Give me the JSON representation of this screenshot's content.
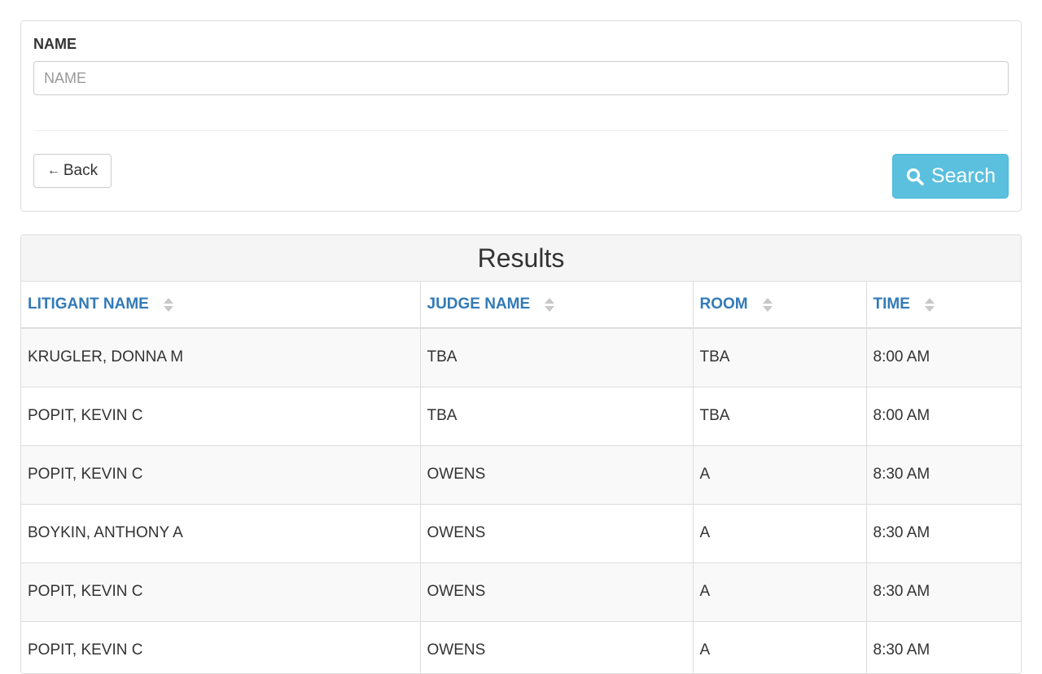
{
  "search_form": {
    "name_label": "NAME",
    "name_placeholder": "NAME",
    "name_value": "",
    "back_label": "Back",
    "back_arrow": "←",
    "search_label": "Search",
    "search_icon": "search-icon",
    "search_color": "#5bc0de"
  },
  "results": {
    "heading": "Results",
    "link_color": "#337ab7",
    "columns": [
      {
        "label": "LITIGANT NAME",
        "sort_icon": "sort-icon"
      },
      {
        "label": "JUDGE NAME",
        "sort_icon": "sort-icon"
      },
      {
        "label": "ROOM",
        "sort_icon": "sort-icon"
      },
      {
        "label": "TIME",
        "sort_icon": "sort-icon"
      }
    ],
    "rows": [
      {
        "litigant": "KRUGLER, DONNA M",
        "judge": "TBA",
        "room": "TBA",
        "time": "8:00 AM"
      },
      {
        "litigant": "POPIT, KEVIN C",
        "judge": "TBA",
        "room": "TBA",
        "time": "8:00 AM"
      },
      {
        "litigant": "POPIT, KEVIN C",
        "judge": "OWENS",
        "room": "A",
        "time": "8:30 AM"
      },
      {
        "litigant": "BOYKIN, ANTHONY A",
        "judge": "OWENS",
        "room": "A",
        "time": "8:30 AM"
      },
      {
        "litigant": "POPIT, KEVIN C",
        "judge": "OWENS",
        "room": "A",
        "time": "8:30 AM"
      },
      {
        "litigant": "POPIT, KEVIN C",
        "judge": "OWENS",
        "room": "A",
        "time": "8:30 AM"
      }
    ]
  }
}
